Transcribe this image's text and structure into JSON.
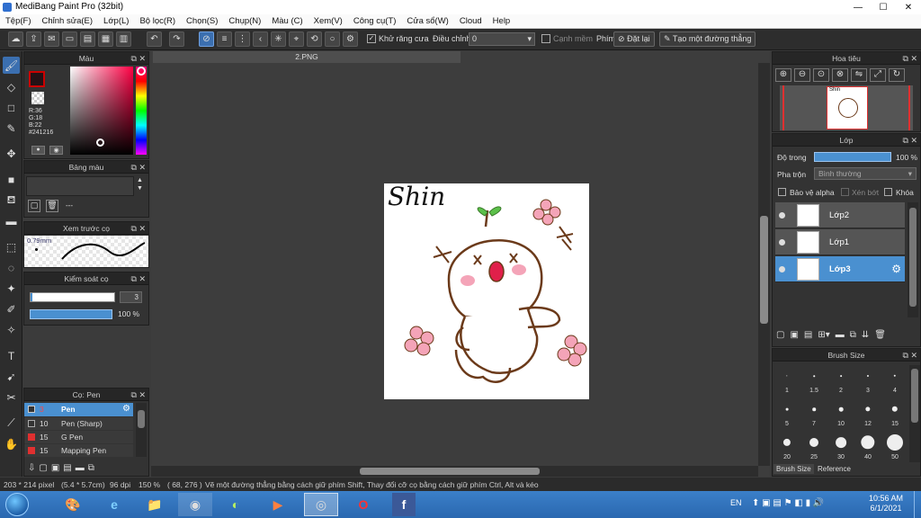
{
  "window": {
    "title": "MediBang Paint Pro (32bit)",
    "minimize": "—",
    "maximize": "☐",
    "close": "✕"
  },
  "menu": [
    "Tệp(F)",
    "Chỉnh sửa(E)",
    "Lớp(L)",
    "Bộ lọc(R)",
    "Chọn(S)",
    "Chụp(N)",
    "Màu (C)",
    "Xem(V)",
    "Công cụ(T)",
    "Cửa sổ(W)",
    "Cloud",
    "Help"
  ],
  "toolbar": {
    "antialias_label": "Khử răng cưa",
    "antialias_checked": true,
    "correction_label": "Điều chỉnh",
    "correction_value": "0",
    "grid_snap_label": "Cạnh mềm",
    "key_label": "Phím",
    "reset_label": "Đặt lại",
    "straight_line_label": "Tạo một đường thẳng"
  },
  "color_panel": {
    "title": "Màu",
    "r": "R:36",
    "g": "G:18",
    "b": "B:22",
    "hex": "#241216",
    "fg_color": "#cc0000"
  },
  "palette_panel": {
    "title": "Bảng màu",
    "placeholder": "---"
  },
  "brush_preview_panel": {
    "title": "Xem trước cọ",
    "size": "0.79mm"
  },
  "brush_control_panel": {
    "title": "Kiểm soát cọ",
    "size_value": "3",
    "opacity_value": "100 %",
    "opacity_fraction": 1.0
  },
  "brush_list_panel": {
    "title": "Cọ: Pen",
    "items": [
      {
        "size": "3",
        "name": "Pen",
        "color": "#333333",
        "selected": true
      },
      {
        "size": "10",
        "name": "Pen (Sharp)",
        "color": "#333333",
        "selected": false
      },
      {
        "size": "15",
        "name": "G Pen",
        "color": "#e03030",
        "selected": false
      },
      {
        "size": "15",
        "name": "Mapping Pen",
        "color": "#e03030",
        "selected": false
      }
    ]
  },
  "document": {
    "tab_name": "2.PNG",
    "handwritten_text": "Shin"
  },
  "navigator_panel": {
    "title": "Hoa tiêu"
  },
  "layer_panel": {
    "title": "Lớp",
    "opacity_label": "Độ trong",
    "opacity_value": "100 %",
    "opacity_fraction": 1.0,
    "blend_label": "Pha trộn",
    "blend_value": "Bình thường",
    "protect_alpha_label": "Bảo vệ alpha",
    "clipping_label": "Xén bớt",
    "lock_label": "Khóa",
    "layers": [
      {
        "name": "Lớp2",
        "selected": false
      },
      {
        "name": "Lớp1",
        "selected": false
      },
      {
        "name": "Lớp3",
        "selected": true
      }
    ]
  },
  "brush_size_panel": {
    "title": "Brush Size",
    "sizes": [
      "1",
      "1.5",
      "2",
      "3",
      "4",
      "5",
      "7",
      "10",
      "12",
      "15",
      "20",
      "25",
      "30",
      "40",
      "50"
    ],
    "tabs": [
      "Brush Size",
      "Reference"
    ]
  },
  "status": {
    "canvas_size": "203 * 214 pixel",
    "physical_size": "(5.4 * 5.7cm)",
    "dpi": "96 dpi",
    "zoom": "150 %",
    "cursor": "( 68, 276 )",
    "hint": "Vẽ một đường thẳng bằng cách giữ phím Shift, Thay đổi cỡ cọ bằng cách giữ phím Ctrl, Alt và kéo"
  },
  "taskbar": {
    "language": "EN",
    "time": "10:56 AM",
    "date": "6/1/2021"
  }
}
